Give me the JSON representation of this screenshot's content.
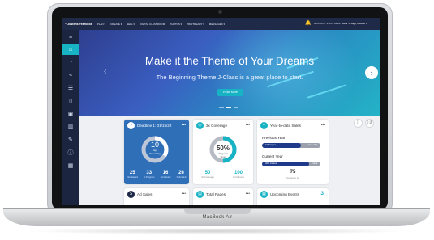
{
  "topbar": {
    "logo": "~ Jostens Yearbook",
    "nav": [
      "PLAN ▾",
      "CREATE ▾",
      "SELL ▾",
      "DIGITAL CLASSROOM",
      "PHOTOS ▾",
      "PRINTREADY ▾",
      "MESSAGES ▾"
    ],
    "account": "ACCOUNT INFO / HELP",
    "user": "Dear Jr High, Adviser ▾"
  },
  "hero": {
    "title": "Make it the Theme of Your Dreams",
    "subtitle": "The Beginning Theme J-Class is a great place to start.",
    "button": "Read More",
    "slides": 3,
    "active_slide": 1
  },
  "deadline": {
    "title": "Deadline 1: 01/15/22",
    "center_value": "10",
    "center_label": "Days Remaining",
    "stats": [
      {
        "value": "25",
        "label": "Not Started"
      },
      {
        "value": "33",
        "label": "In Progress"
      },
      {
        "value": "16",
        "label": "Completed"
      },
      {
        "value": "26",
        "label": "Submitted"
      }
    ]
  },
  "coverage": {
    "title": "3x Coverage",
    "percent": "50%",
    "percent_label": "Tagged 3 Times",
    "fill_fraction": 0.5,
    "left_value": "50",
    "left_label": "3x Coverage",
    "right_value": "100",
    "right_label": "Enrollment"
  },
  "ytd": {
    "title": "Year-to-date Sales",
    "previous_label": "Previous Year",
    "previous_bar_left": "100 Copies",
    "previous_bar_right": "Goal: 150",
    "previous_fraction": 0.66,
    "current_label": "Current Year",
    "current_bar_left": "40% Copies",
    "current_bar_right": "Goal",
    "current_fraction": 0.8,
    "value": "75",
    "value_label": "Copies to go"
  },
  "bottom_cards": {
    "ad_sales": "Ad Sales",
    "total_pages": "Total Pages",
    "upcoming_events": "Upcoming Events",
    "upcoming_count": "3"
  },
  "laptop": {
    "brand": "MacBook Air"
  },
  "colors": {
    "accent": "#17b3c4",
    "navy": "#1f2a48",
    "deadline_blue": "#2f6fb8"
  }
}
